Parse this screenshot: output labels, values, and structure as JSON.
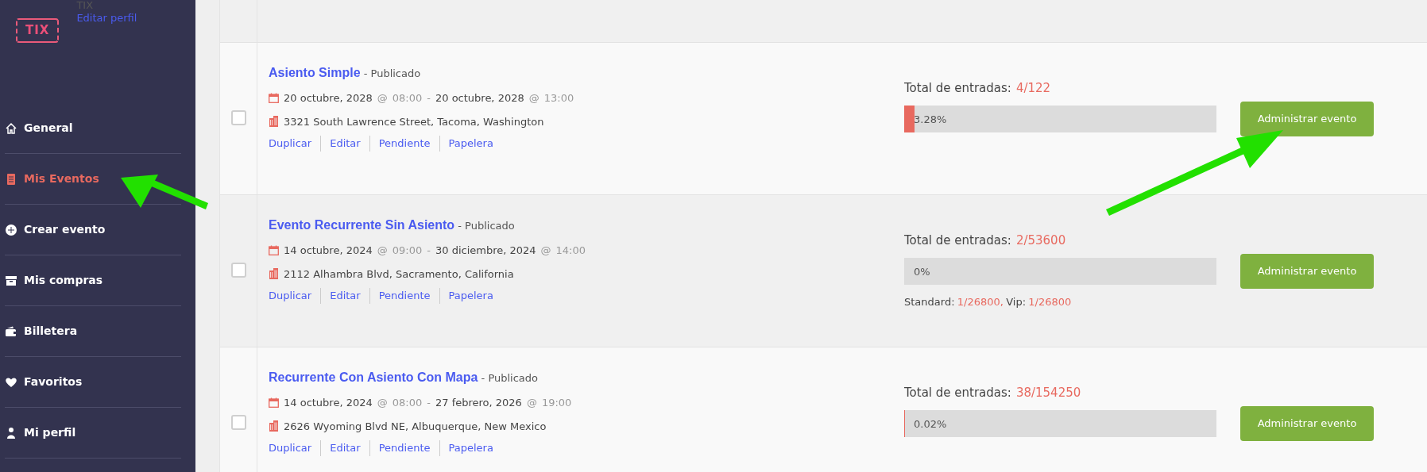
{
  "sidebar": {
    "logo": "TIX",
    "user_name": "TIX",
    "edit_profile": "Editar perfil",
    "items": [
      {
        "label": "General",
        "selected": false
      },
      {
        "label": "Mis Eventos",
        "selected": true
      },
      {
        "label": "Crear evento",
        "selected": false
      },
      {
        "label": "Mis compras",
        "selected": false
      },
      {
        "label": "Billetera",
        "selected": false
      },
      {
        "label": "Favoritos",
        "selected": false
      },
      {
        "label": "Mi perfil",
        "selected": false
      }
    ]
  },
  "events": [
    {
      "title": "Asiento Simple",
      "status": "- Publicado",
      "checked": false,
      "start_date": "20 octubre, 2028",
      "start_at": "@",
      "start_time": "08:00",
      "dash": "-",
      "end_at": "@",
      "end_date": "20 octubre, 2028",
      "end_time": "13:00",
      "address": "3321 South Lawrence Street, Tacoma, Washington",
      "actions": [
        "Duplicar",
        "Editar",
        "Pendiente",
        "Papelera"
      ],
      "total_label": "Total de entradas:",
      "total_value": "4/122",
      "level": 0.0328,
      "percent": "3.28%",
      "button": "Administrar evento"
    },
    {
      "title": "Evento Recurrente Sin Asiento",
      "status": "- Publicado",
      "checked": false,
      "start_date": "14 octubre, 2024",
      "start_at": "@",
      "start_time": "09:00",
      "dash": "-",
      "end_at": "@",
      "end_date": "30 diciembre, 2024",
      "end_time": "14:00",
      "address": "2112 Alhambra Blvd, Sacramento, California",
      "actions": [
        "Duplicar",
        "Editar",
        "Pendiente",
        "Papelera"
      ],
      "total_label": "Total de entradas:",
      "total_value": "2/53600",
      "level": 0,
      "percent": "0%",
      "breakdown": [
        {
          "label": "Standard:",
          "value": "1/26800,"
        },
        {
          "label": "Vip:",
          "value": "1/26800"
        }
      ],
      "button": "Administrar evento"
    },
    {
      "title": "Recurrente Con Asiento Con Mapa",
      "status": "- Publicado",
      "checked": false,
      "start_date": "14 octubre, 2024",
      "start_at": "@",
      "start_time": "08:00",
      "dash": "-",
      "end_at": "@",
      "end_date": "27 febrero, 2026",
      "end_time": "19:00",
      "address": "2626 Wyoming Blvd NE, Albuquerque, New Mexico",
      "actions": [
        "Duplicar",
        "Editar",
        "Pendiente",
        "Papelera"
      ],
      "total_label": "Total de entradas:",
      "total_value": "38/154250",
      "level": 0.0002,
      "percent": "0.02%",
      "button": "Administrar evento"
    }
  ]
}
